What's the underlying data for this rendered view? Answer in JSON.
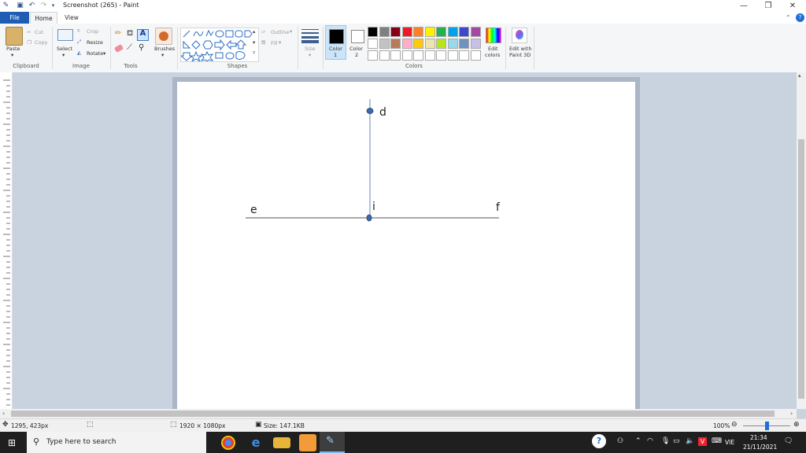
{
  "window": {
    "title": "Screenshot (265) - Paint",
    "minimize_icon": "minimize-icon",
    "maximize_icon": "restore-icon",
    "close_icon": "close-icon"
  },
  "tabs": {
    "file": "File",
    "home": "Home",
    "view": "View"
  },
  "clipboard": {
    "paste": "Paste",
    "cut": "Cut",
    "copy": "Copy",
    "group": "Clipboard"
  },
  "image": {
    "select": "Select",
    "crop": "Crop",
    "resize": "Resize",
    "rotate": "Rotate",
    "group": "Image"
  },
  "tools": {
    "group": "Tools",
    "brushes": "Brushes"
  },
  "shapes": {
    "outline": "Outline",
    "fill": "Fill",
    "group": "Shapes",
    "size": "Size"
  },
  "colors": {
    "color1": "Color",
    "color1_num": "1",
    "color2": "Color",
    "color2_num": "2",
    "edit_colors_1": "Edit",
    "edit_colors_2": "colors",
    "paint3d_1": "Edit with",
    "paint3d_2": "Paint 3D",
    "group": "Colors",
    "palette_row1": [
      "#000000",
      "#7f7f7f",
      "#880015",
      "#ed1c24",
      "#ff7f27",
      "#fff200",
      "#22b14c",
      "#00a2e8",
      "#3f48cc",
      "#a349a4"
    ],
    "palette_row2": [
      "#ffffff",
      "#c3c3c3",
      "#b97a57",
      "#ffaec9",
      "#ffc90e",
      "#efe4b0",
      "#b5e61d",
      "#99d9ea",
      "#7092be",
      "#c8bfe7"
    ]
  },
  "drawing": {
    "label_d": "d",
    "label_e": "e",
    "label_i": "i",
    "label_f": "f"
  },
  "status": {
    "cursor_pos": "1295, 423px",
    "dimensions": "1920 × 1080px",
    "size": "Size: 147.1KB",
    "zoom": "100%"
  },
  "taskbar": {
    "search_placeholder": "Type here to search",
    "lang": "VIE",
    "time": "21:34",
    "date": "21/11/2021"
  }
}
